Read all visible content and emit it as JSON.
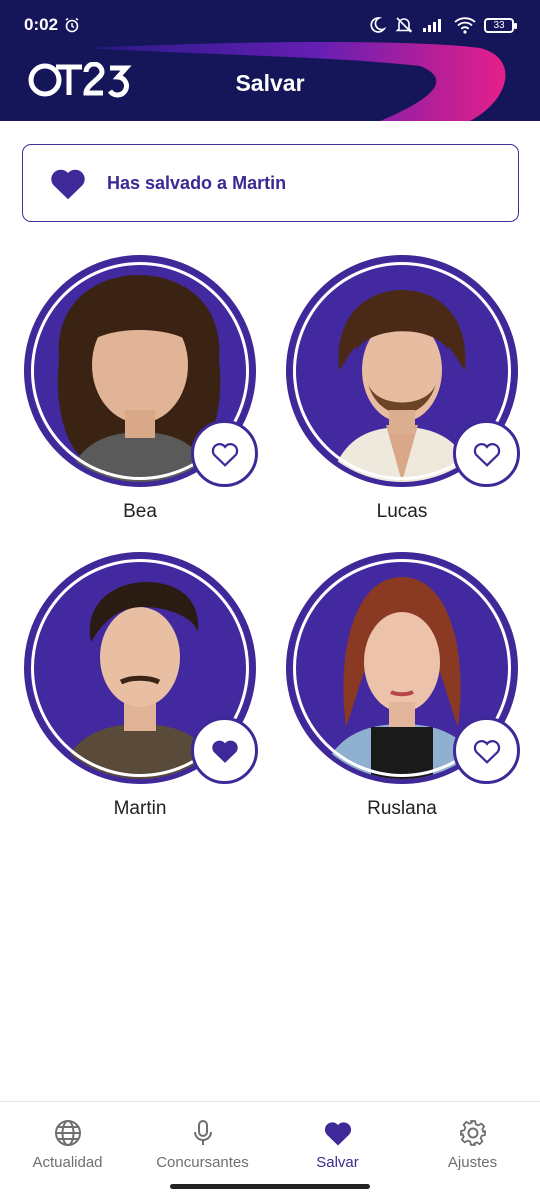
{
  "status_bar": {
    "time": "0:02",
    "battery": "33"
  },
  "header": {
    "logo": "OT23",
    "title": "Salvar"
  },
  "notice": {
    "icon": "heart-icon",
    "text": "Has salvado a Martin"
  },
  "contestants": [
    {
      "name": "Bea",
      "saved": false
    },
    {
      "name": "Lucas",
      "saved": false
    },
    {
      "name": "Martin",
      "saved": true
    },
    {
      "name": "Ruslana",
      "saved": false
    }
  ],
  "bottom_nav": {
    "items": [
      {
        "label": "Actualidad",
        "icon": "globe-icon",
        "active": false
      },
      {
        "label": "Concursantes",
        "icon": "microphone-icon",
        "active": false
      },
      {
        "label": "Salvar",
        "icon": "heart-icon",
        "active": true
      },
      {
        "label": "Ajustes",
        "icon": "gear-icon",
        "active": false
      }
    ]
  },
  "colors": {
    "primary": "#3f2898",
    "header_bg": "#15155a",
    "accent_pink": "#e0218a"
  }
}
